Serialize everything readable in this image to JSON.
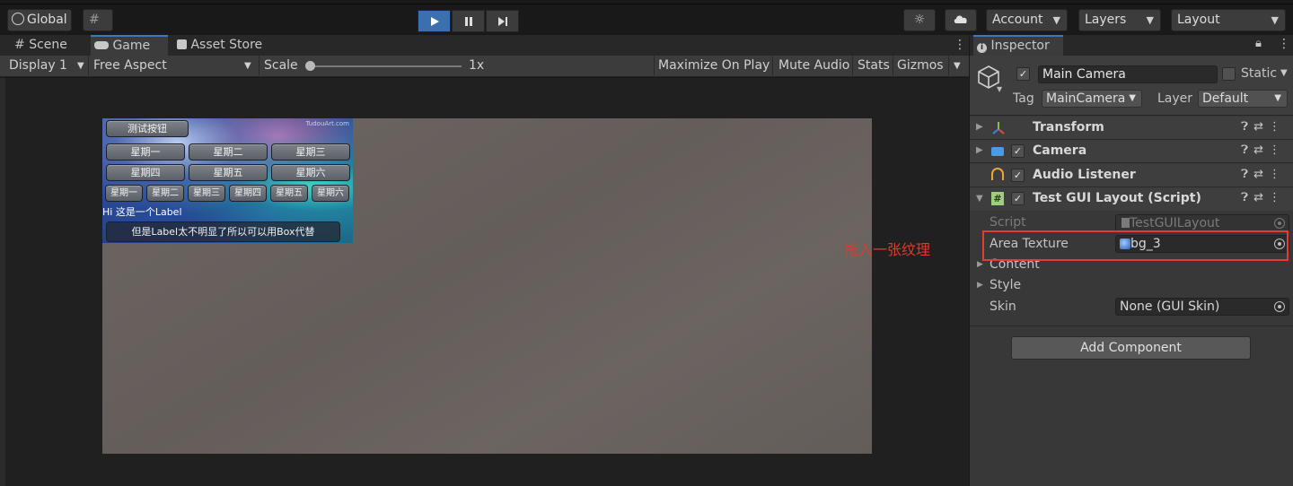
{
  "toolbar": {
    "global_label": "Global",
    "account_label": "Account",
    "layers_label": "Layers",
    "layout_label": "Layout"
  },
  "game_panel": {
    "tabs": [
      {
        "label": "Scene",
        "icon": "scene-grid-icon"
      },
      {
        "label": "Game",
        "icon": "gamepad-icon",
        "active": true
      },
      {
        "label": "Asset Store",
        "icon": "shopping-bag-icon"
      }
    ],
    "display": "Display 1",
    "aspect": "Free Aspect",
    "scale_label": "Scale",
    "scale_value": "1x",
    "maximize_on_play": "Maximize On Play",
    "mute_audio": "Mute Audio",
    "stats": "Stats",
    "gizmos": "Gizmos"
  },
  "gui": {
    "test_button": "测试按钮",
    "row1": [
      "星期一",
      "星期二",
      "星期三"
    ],
    "row2": [
      "星期四",
      "星期五",
      "星期六"
    ],
    "row3": [
      "星期一",
      "星期二",
      "星期三",
      "星期四",
      "星期五",
      "星期六"
    ],
    "label": "Hi 这是一个Label",
    "box": "但是Label太不明显了所以可以用Box代替",
    "watermark": "TudouArt.com"
  },
  "annotation": "拖入一张纹理",
  "inspector": {
    "tab_label": "Inspector",
    "object_name": "Main Camera",
    "static_label": "Static",
    "tag_label": "Tag",
    "tag_value": "MainCamera",
    "layer_label": "Layer",
    "layer_value": "Default",
    "components": [
      {
        "name": "Transform"
      },
      {
        "name": "Camera"
      },
      {
        "name": "Audio Listener"
      },
      {
        "name": "Test GUI Layout (Script)"
      }
    ],
    "script_label": "Script",
    "script_value": "TestGUILayout",
    "area_texture_label": "Area Texture",
    "area_texture_value": "bg_3",
    "content_label": "Content",
    "style_label": "Style",
    "skin_label": "Skin",
    "skin_value": "None (GUI Skin)",
    "add_component": "Add Component"
  },
  "colors": {
    "accent_blue": "#3a6fb0",
    "annotation_red": "#e2382e",
    "canvas_bg": "#6a6360"
  }
}
